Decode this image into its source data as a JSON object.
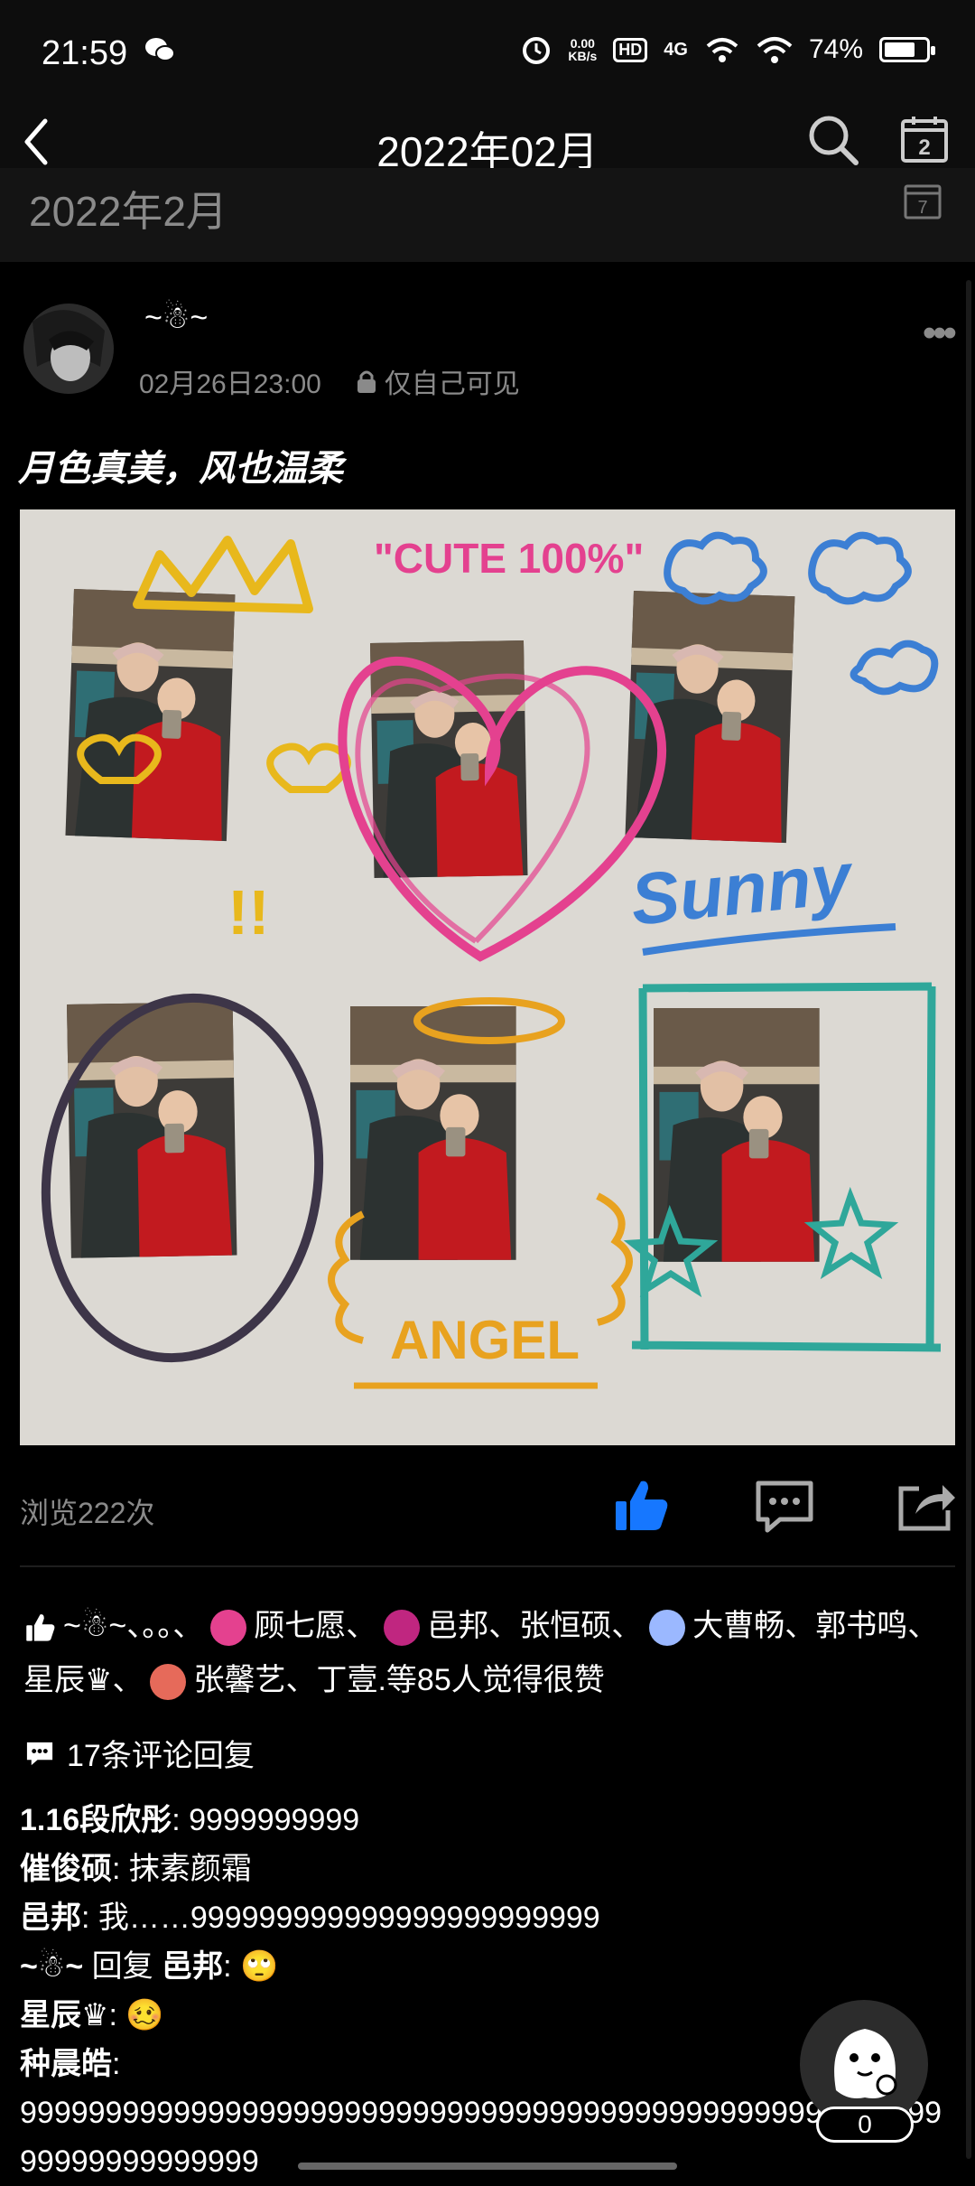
{
  "status": {
    "time": "21:59",
    "network_speed": "0.00\nKB/s",
    "hd": "HD",
    "network": "4G",
    "battery": "74%",
    "battery_level": 0.74
  },
  "header": {
    "title": "2022年02月",
    "section_title": "2022年2月",
    "calendar_day": "7",
    "calendar_icon_num": "2"
  },
  "post": {
    "author": "~☃~",
    "date": "02月26日23:00",
    "privacy": "仅自己可见",
    "text": "月色真美，风也温柔",
    "views": "浏览222次"
  },
  "photo_captions": {
    "cute": "\"CUTE 100%\"",
    "sunny": "Sunny",
    "angel": "ANGEL",
    "exclaim": "!!"
  },
  "likes": {
    "part1": "~☃~、。。、",
    "name1": "顾七愿、",
    "name2": "邑邦、张恒硕、",
    "name3": "大曹畅、郭书鸣、星辰♛、",
    "name4": "张馨艺、丁壹.等85人觉得很赞"
  },
  "comments": {
    "count_label": "17条评论回复",
    "items": [
      {
        "author": "1.16段欣彤",
        "text": ": 9999999999"
      },
      {
        "author": "催俊硕",
        "text": ": 抹素颜霜"
      },
      {
        "author": "邑邦",
        "text": ": 我……999999999999999999999999"
      },
      {
        "author": "~☃~",
        "reply_word": " 回复 ",
        "reply_to": "邑邦",
        "text": ": 🙄"
      },
      {
        "author": "星辰♛",
        "text": ": 🥴"
      },
      {
        "author": "种晨皓",
        "text": ":"
      },
      {
        "author": "",
        "text": "99999999999999999999999999999999999999999999999999999999999999999999"
      }
    ]
  },
  "float_badge": "0",
  "colors": {
    "accent_blue": "#1677ff",
    "muted": "#8a8a8a",
    "pink": "#e4418f",
    "orange": "#e8a21f",
    "sky": "#3c7fd4",
    "teal": "#2fa79a"
  }
}
